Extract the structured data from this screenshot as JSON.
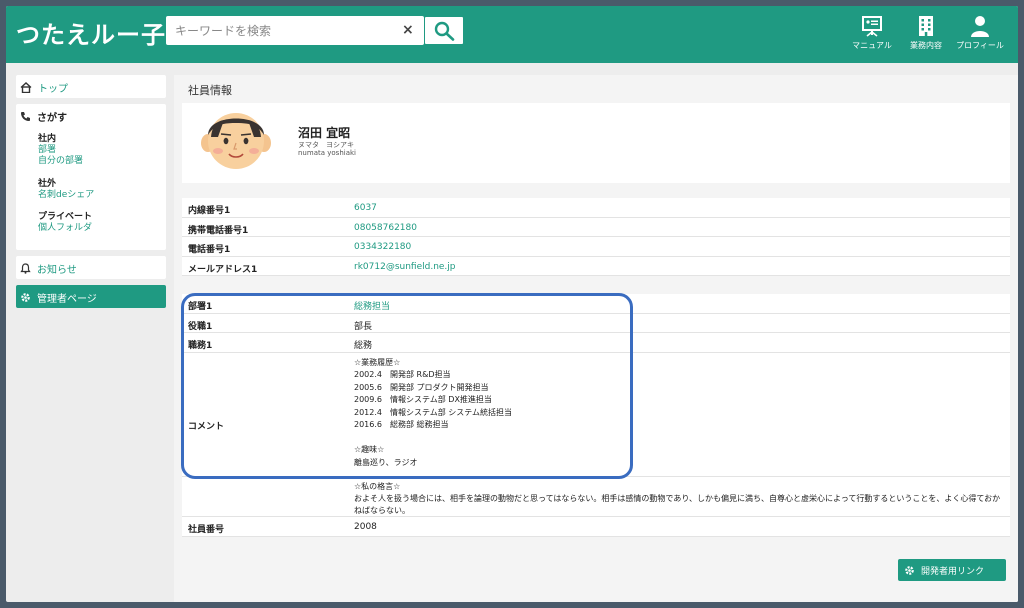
{
  "header": {
    "logo": "つたえルー子",
    "search_placeholder": "キーワードを検索",
    "nav": [
      {
        "label": "マニュアル",
        "icon": "presentation-board-icon"
      },
      {
        "label": "業務内容",
        "icon": "building-icon"
      },
      {
        "label": "プロフィール",
        "icon": "user-icon"
      }
    ]
  },
  "sidebar": {
    "top": "トップ",
    "search_title": "さがす",
    "groups": [
      {
        "title": "社内",
        "links": [
          "部署",
          "自分の部署"
        ]
      },
      {
        "title": "社外",
        "links": [
          "名刺deシェア"
        ]
      },
      {
        "title": "プライベート",
        "links": [
          "個人フォルダ"
        ]
      }
    ],
    "news": "お知らせ",
    "admin": "管理者ページ"
  },
  "main": {
    "title": "社員情報",
    "profile": {
      "name": "沼田 宜昭",
      "kana": "ヌマタ　ヨシアキ",
      "romaji": "numata yoshiaki"
    },
    "contact": [
      {
        "label": "内線番号1",
        "value": "6037"
      },
      {
        "label": "携帯電話番号1",
        "value": "08058762180"
      },
      {
        "label": "電話番号1",
        "value": "0334322180"
      },
      {
        "label": "メールアドレス1",
        "value": "rk0712@sunfield.ne.jp"
      }
    ],
    "job": [
      {
        "label": "部署1",
        "value": "総務担当"
      },
      {
        "label": "役職1",
        "value": "部長"
      },
      {
        "label": "職務1",
        "value": "総務"
      }
    ],
    "comment_label": "コメント",
    "comment_lines": [
      "☆業務履歴☆",
      "2002.4　開発部 R&D担当",
      "2005.6　開発部 プロダクト開発担当",
      "2009.6　情報システム部 DX推進担当",
      "2012.4　情報システム部 システム統括担当",
      "2016.6　総務部 総務担当",
      "",
      "☆趣味☆",
      "離島巡り、ラジオ"
    ],
    "motto_lines": [
      "☆私の格言☆",
      "およそ人を扱う場合には、相手を論理の動物だと思ってはならない。相手は感情の動物であり、しかも偏見に満ち、自尊心と虚栄心によって行動するということを、よく心得ておかねばならない。"
    ],
    "employee_id_label": "社員番号",
    "employee_id": "2008",
    "dev_link": "開発者用リンク"
  },
  "colors": {
    "accent": "#1f9a82",
    "highlight": "#3a6cc0"
  }
}
